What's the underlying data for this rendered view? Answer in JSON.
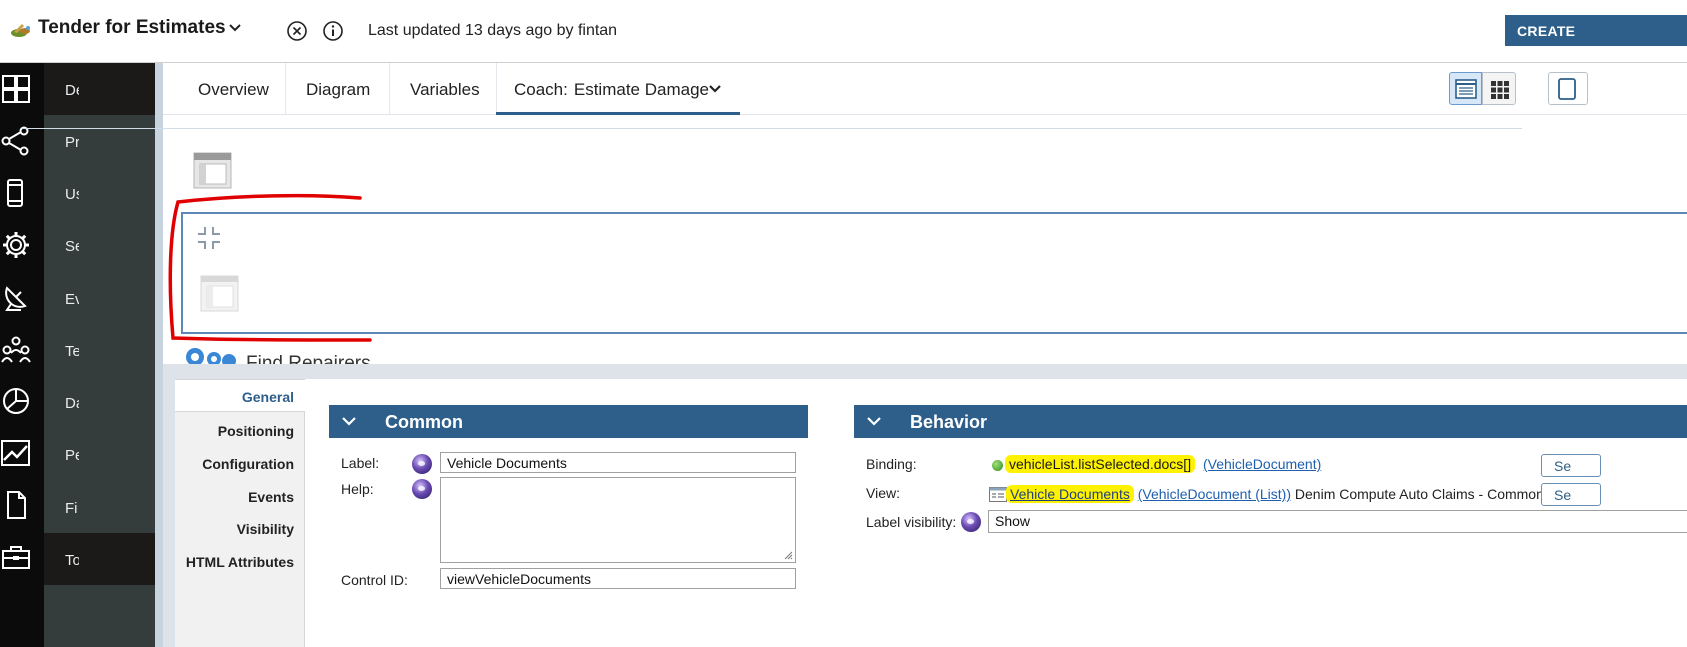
{
  "topbar": {
    "title": "Tender for Estimates",
    "last_updated": "Last updated 13 days ago by fintan",
    "create_label": "CREATE"
  },
  "nav": {
    "items": [
      {
        "label": "De",
        "icon": "dashboard-icon"
      },
      {
        "label": "Pr",
        "icon": "process-flow-icon"
      },
      {
        "label": "Us",
        "icon": "mobile-device-icon"
      },
      {
        "label": "Se",
        "icon": "gear-icon"
      },
      {
        "label": "Ev",
        "icon": "satellite-dish-icon"
      },
      {
        "label": "Te",
        "icon": "team-icon"
      },
      {
        "label": "Da",
        "icon": "pie-chart-icon"
      },
      {
        "label": "Pe",
        "icon": "trend-chart-icon"
      },
      {
        "label": "Fi",
        "icon": "file-icon"
      },
      {
        "label": "To",
        "icon": "toolbox-icon"
      }
    ]
  },
  "tabs": {
    "overview": "Overview",
    "diagram": "Diagram",
    "variables": "Variables",
    "coach_prefix": "Coach:",
    "coach_name": "Estimate Damage"
  },
  "canvas": {
    "find_repairers": "Find Repairers"
  },
  "properties": {
    "side_tabs": [
      "General",
      "Positioning",
      "Configuration",
      "Events",
      "Visibility",
      "HTML Attributes"
    ],
    "common": {
      "title": "Common",
      "label_label": "Label:",
      "label_value": "Vehicle Documents",
      "help_label": "Help:",
      "help_value": "",
      "control_id_label": "Control ID:",
      "control_id_value": "viewVehicleDocuments"
    },
    "behavior": {
      "title": "Behavior",
      "binding_label": "Binding:",
      "binding_value": "vehicleList.listSelected.docs[]",
      "binding_type": "(VehicleDocument)",
      "view_label": "View:",
      "view_value": "Vehicle Documents",
      "view_type": "(VehicleDocument (List))",
      "view_toolkit": "Denim Compute Auto Claims - Common",
      "label_visibility_label": "Label visibility:",
      "label_visibility_value": "Show",
      "select_btn": "Se"
    }
  },
  "colors": {
    "accent": "#2d5f8a",
    "highlight": "#fff200",
    "annotation": "#e00000",
    "nav_dark": "#0b0b0b",
    "nav_panel": "#343d3b"
  }
}
